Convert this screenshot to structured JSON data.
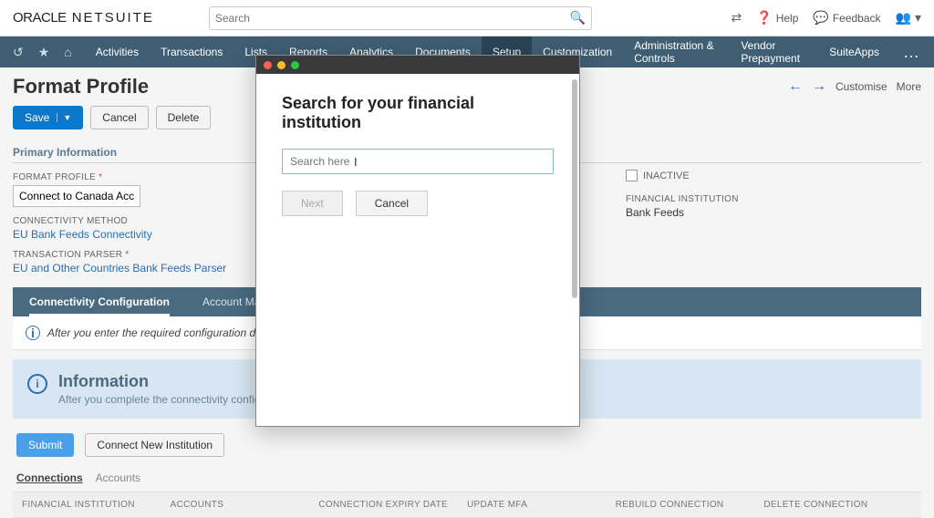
{
  "logo": {
    "brand1": "ORACLE",
    "brand2": "NETSUITE"
  },
  "global_search": {
    "placeholder": "Search"
  },
  "top_links": {
    "help": "Help",
    "feedback": "Feedback"
  },
  "nav": {
    "items": [
      "Activities",
      "Transactions",
      "Lists",
      "Reports",
      "Analytics",
      "Documents",
      "Setup",
      "Customization",
      "Administration & Controls",
      "Vendor Prepayment",
      "SuiteApps"
    ],
    "active_index": 6
  },
  "page": {
    "title": "Format Profile",
    "customise": "Customise",
    "more": "More",
    "save": "Save",
    "cancel": "Cancel",
    "delete": "Delete"
  },
  "primary": {
    "section": "Primary Information",
    "format_profile_label": "FORMAT PROFILE",
    "format_profile_value": "Connect to Canada Account",
    "connectivity_method_label": "CONNECTIVITY METHOD",
    "connectivity_method_value": "EU Bank Feeds Connectivity",
    "transaction_parser_label": "TRANSACTION PARSER",
    "transaction_parser_value": "EU and Other Countries Bank Feeds Parser",
    "inactive_label": "INACTIVE",
    "fin_inst_label": "FINANCIAL INSTITUTION",
    "fin_inst_value": "Bank Feeds"
  },
  "subtabs": {
    "conn": "Connectivity Configuration",
    "map": "Account Mapping"
  },
  "info_after": "After you enter the required configuration data, continu",
  "info_box": {
    "title": "Information",
    "sub": "After you complete the connectivity config"
  },
  "actions": {
    "submit": "Submit",
    "connect_new": "Connect New Institution"
  },
  "inner_tabs": {
    "connections": "Connections",
    "accounts": "Accounts"
  },
  "table": {
    "cols": [
      "FINANCIAL INSTITUTION",
      "ACCOUNTS",
      "CONNECTION EXPIRY DATE",
      "UPDATE MFA",
      "REBUILD CONNECTION",
      "DELETE CONNECTION"
    ]
  },
  "modal": {
    "title": "Search for your financial institution",
    "placeholder": "Search here",
    "next": "Next",
    "cancel": "Cancel"
  }
}
